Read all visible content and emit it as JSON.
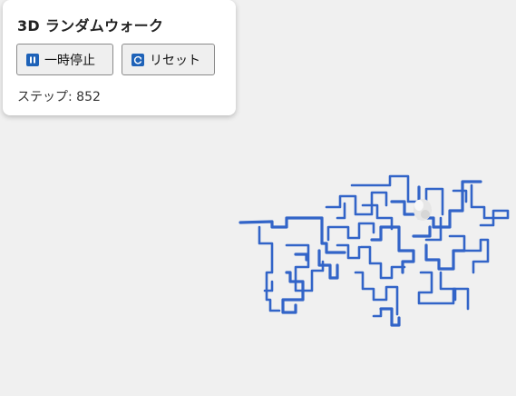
{
  "panel": {
    "title": "3D ランダムウォーク",
    "pause_label": "一時停止",
    "reset_label": "リセット",
    "step_label": "ステップ:",
    "step_count": "852"
  },
  "icons": {
    "pause": "pause-icon",
    "reset": "refresh-icon"
  },
  "colors": {
    "background": "#f0f0f0",
    "path": "#3264c8",
    "walker": "#e8e8e8",
    "icon": "#1e62b8"
  }
}
